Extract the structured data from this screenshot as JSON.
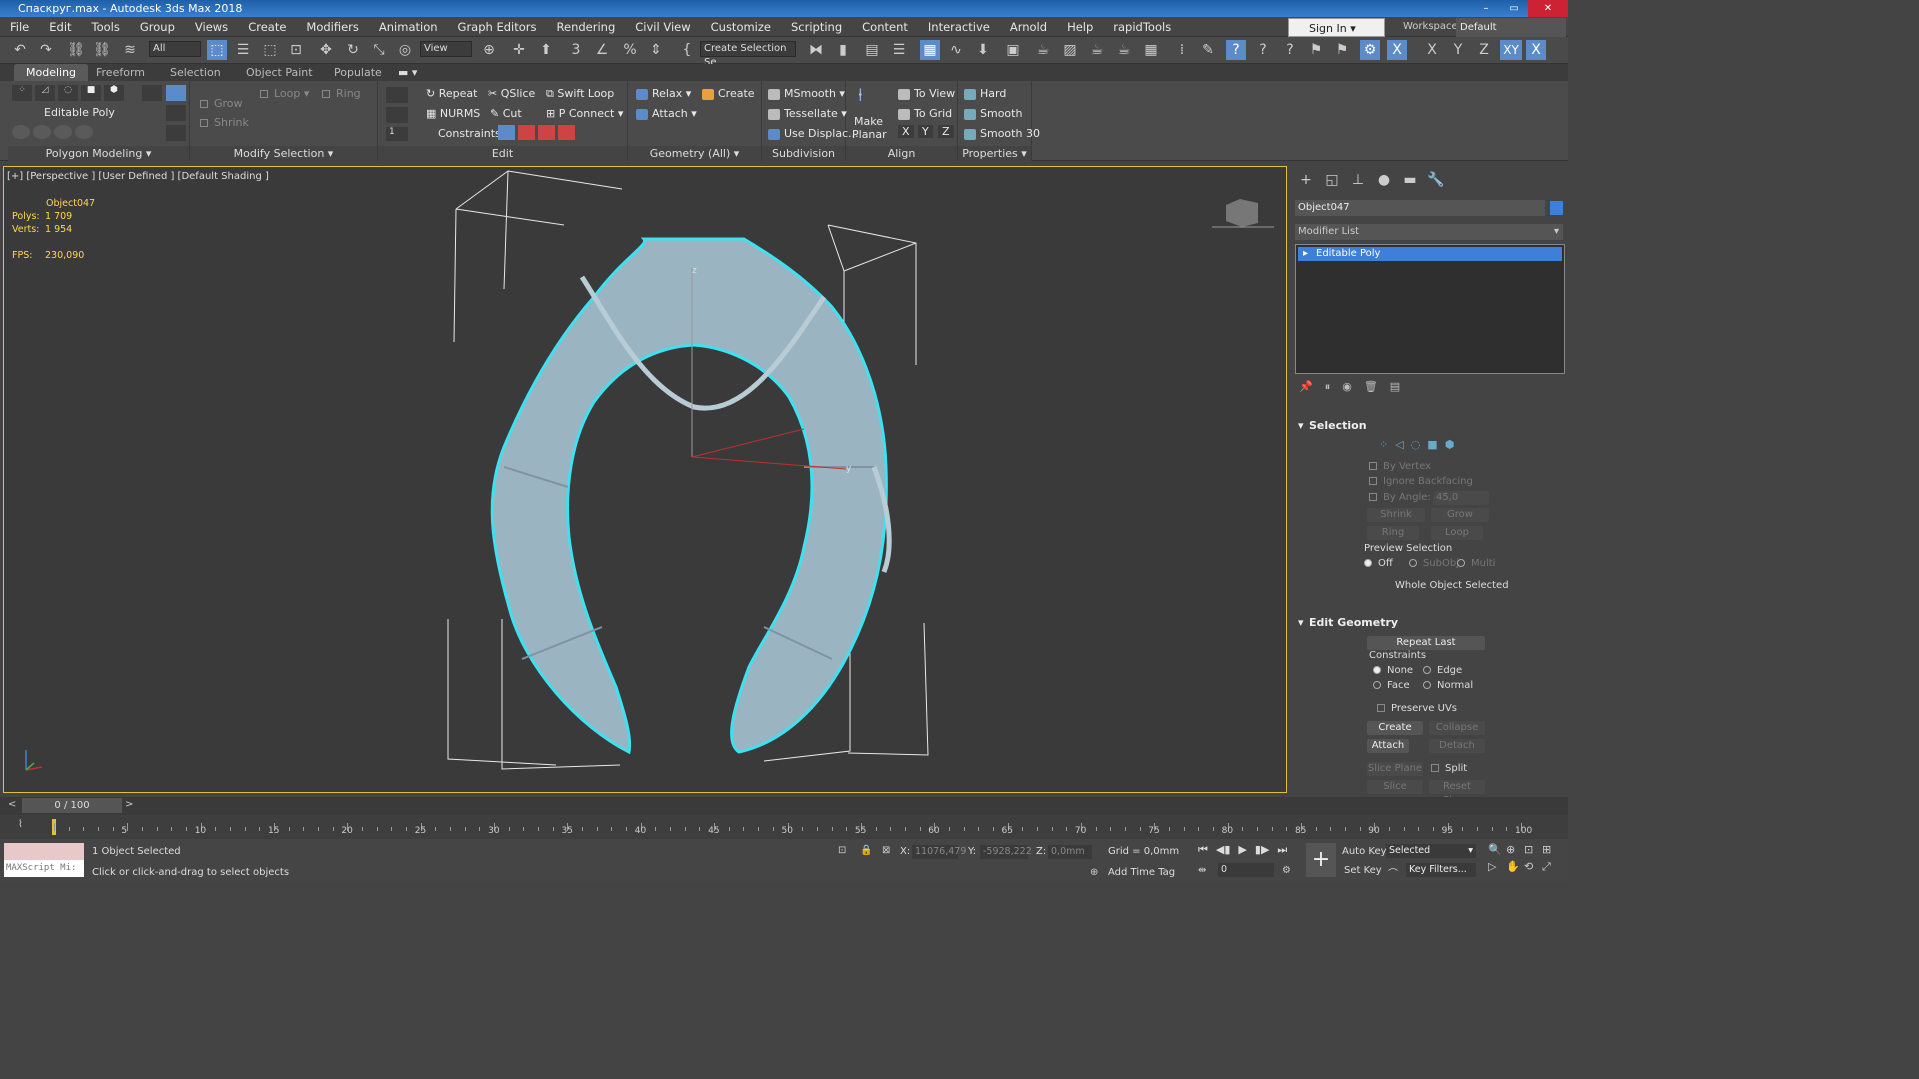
{
  "app": {
    "title": "Спаскруг.max - Autodesk 3ds Max 2018"
  },
  "menu": [
    "File",
    "Edit",
    "Tools",
    "Group",
    "Views",
    "Create",
    "Modifiers",
    "Animation",
    "Graph Editors",
    "Rendering",
    "Civil View",
    "Customize",
    "Scripting",
    "Content",
    "Interactive",
    "Arnold",
    "Help",
    "rapidTools"
  ],
  "account": {
    "sign_in": "Sign In",
    "workspaces_label": "Workspaces:",
    "workspace": "Default"
  },
  "toolbar": {
    "filter": "All",
    "view": "View",
    "selection_set": "Create Selection Se"
  },
  "ribbon": {
    "tabs": [
      "Modeling",
      "Freeform",
      "Selection",
      "Object Paint",
      "Populate"
    ],
    "active_tab": "Modeling",
    "poly_modeling": {
      "label": "Editable Poly",
      "footer": "Polygon Modeling"
    },
    "modify_selection": {
      "grow": "Grow",
      "shrink": "Shrink",
      "loop": "Loop",
      "ring": "Ring",
      "footer": "Modify Selection"
    },
    "edit": {
      "repeat": "Repeat",
      "qslice": "QSlice",
      "swift_loop": "Swift Loop",
      "nurms": "NURMS",
      "cut": "Cut",
      "p_connect": "P Connect",
      "constraints": "Constraints:",
      "spinner": "1",
      "footer": "Edit"
    },
    "geometry": {
      "relax": "Relax",
      "create": "Create",
      "attach": "Attach",
      "footer": "Geometry (All)"
    },
    "subdivision": {
      "msmooth": "MSmooth",
      "tessellate": "Tessellate",
      "use_displace": "Use Displac...",
      "footer": "Subdivision"
    },
    "align": {
      "make": "Make",
      "planar": "Planar",
      "to_view": "To View",
      "to_grid": "To Grid",
      "x": "X",
      "y": "Y",
      "z": "Z",
      "footer": "Align"
    },
    "properties": {
      "hard": "Hard",
      "smooth": "Smooth",
      "smooth30": "Smooth 30",
      "footer": "Properties"
    }
  },
  "viewport": {
    "label": "[+] [Perspective ] [User Defined ] [Default Shading ]",
    "object": "Object047",
    "polys_label": "Polys:",
    "polys": "1 709",
    "verts_label": "Verts:",
    "verts": "1 954",
    "fps_label": "FPS:",
    "fps": "230,090",
    "axis_z": "z",
    "axis_y": "y"
  },
  "command_panel": {
    "object_name": "Object047",
    "object_color": "#3d7fd9",
    "modifier_list": "Modifier List",
    "stack": [
      "Editable Poly"
    ],
    "selection": {
      "title": "Selection",
      "by_vertex": "By Vertex",
      "ignore_backfacing": "Ignore Backfacing",
      "by_angle": "By Angle:",
      "angle": "45,0",
      "shrink": "Shrink",
      "grow": "Grow",
      "ring": "Ring",
      "loop": "Loop",
      "preview_selection": "Preview Selection",
      "off": "Off",
      "subobj": "SubObj",
      "multi": "Multi",
      "status": "Whole Object Selected"
    },
    "edit_geometry": {
      "title": "Edit Geometry",
      "repeat_last": "Repeat Last",
      "constraints": "Constraints",
      "none": "None",
      "edge": "Edge",
      "face": "Face",
      "normal": "Normal",
      "preserve_uvs": "Preserve UVs",
      "create": "Create",
      "collapse": "Collapse",
      "attach": "Attach",
      "detach": "Detach",
      "slice_plane": "Slice Plane",
      "split": "Split",
      "slice": "Slice",
      "reset_plane": "Reset Plane"
    }
  },
  "timeline": {
    "frame": "0 / 100",
    "ticks": [
      "5",
      "10",
      "15",
      "20",
      "25",
      "30",
      "35",
      "40",
      "45",
      "50",
      "55",
      "60",
      "65",
      "70",
      "75",
      "80",
      "85",
      "90",
      "95",
      "100"
    ]
  },
  "status": {
    "maxscript": "MAXScript Mi:",
    "selected": "1 Object Selected",
    "prompt": "Click or click-and-drag to select objects",
    "x_label": "X:",
    "x": "11076,479",
    "y_label": "Y:",
    "y": "-5928,222",
    "z_label": "Z:",
    "z": "0,0mm",
    "grid": "Grid = 0,0mm",
    "add_time_tag": "Add Time Tag",
    "auto_key": "Auto Key",
    "set_key": "Set Key",
    "key_mode": "Selected",
    "key_filters": "Key Filters...",
    "frame_field": "0"
  }
}
